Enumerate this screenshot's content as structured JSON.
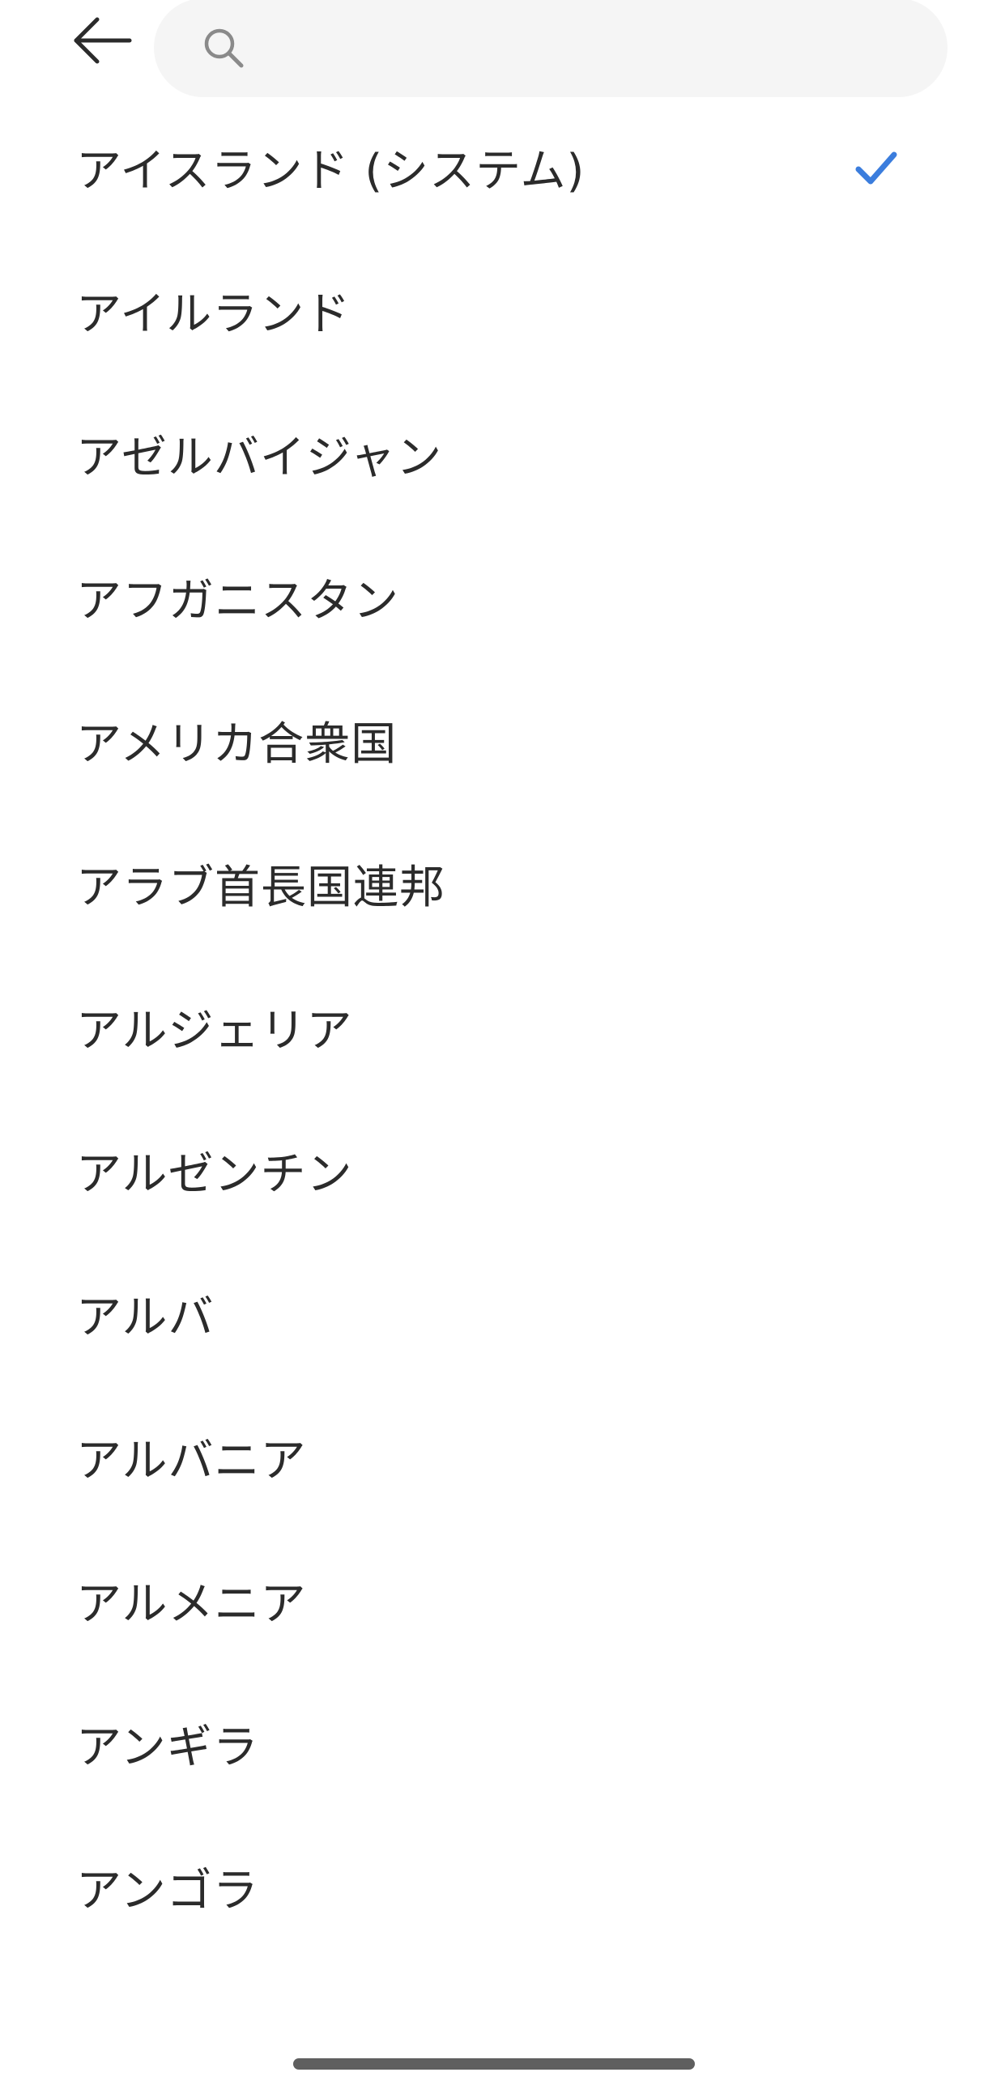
{
  "header": {
    "back_icon": "arrow-left-icon",
    "search": {
      "placeholder": "",
      "value": "",
      "icon": "search-icon"
    }
  },
  "colors": {
    "accent": "#3B7DDD",
    "search_bg": "#F5F5F5",
    "text": "#2B2B2B"
  },
  "countries": {
    "selected_index": 0,
    "items": [
      {
        "label": "アイスランド (システム)"
      },
      {
        "label": "アイルランド"
      },
      {
        "label": "アゼルバイジャン"
      },
      {
        "label": "アフガニスタン"
      },
      {
        "label": "アメリカ合衆国"
      },
      {
        "label": "アラブ首長国連邦"
      },
      {
        "label": "アルジェリア"
      },
      {
        "label": "アルゼンチン"
      },
      {
        "label": "アルバ"
      },
      {
        "label": "アルバニア"
      },
      {
        "label": "アルメニア"
      },
      {
        "label": "アンギラ"
      },
      {
        "label": "アンゴラ"
      }
    ]
  }
}
